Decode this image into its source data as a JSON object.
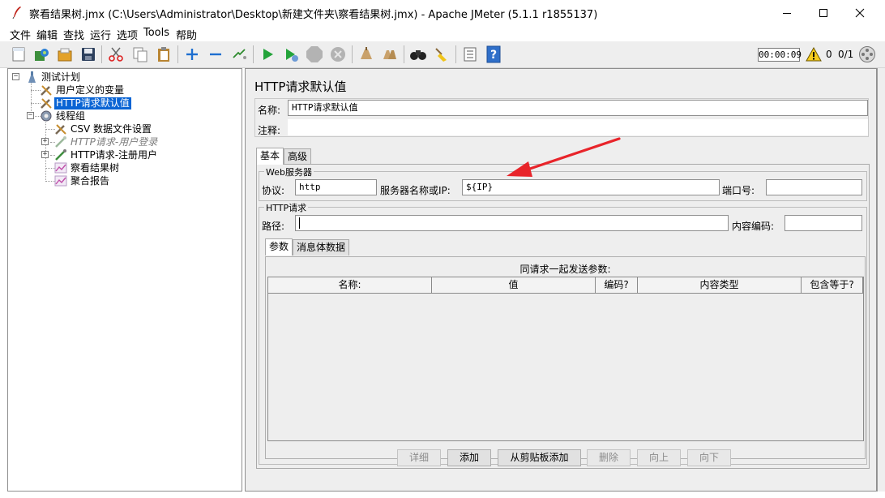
{
  "window": {
    "title": "察看结果树.jmx (C:\\Users\\Administrator\\Desktop\\新建文件夹\\察看结果树.jmx) - Apache JMeter (5.1.1 r1855137)"
  },
  "menu": [
    "文件",
    "编辑",
    "查找",
    "运行",
    "选项",
    "Tools",
    "帮助"
  ],
  "toolbar": {
    "timer": "00:00:09",
    "warning_count": "0",
    "threads": "0/1"
  },
  "tree": [
    {
      "label": "测试计划",
      "icon": "flask-icon"
    },
    {
      "label": "用户定义的变量",
      "icon": "wrench-icon"
    },
    {
      "label": "HTTP请求默认值",
      "icon": "wrench-icon",
      "selected": true
    },
    {
      "label": "线程组",
      "icon": "gear-icon"
    },
    {
      "label": "CSV 数据文件设置",
      "icon": "wrench-icon"
    },
    {
      "label": "HTTP请求-用户登录",
      "icon": "pipette-icon",
      "disabled": true
    },
    {
      "label": "HTTP请求-注册用户",
      "icon": "pipette-icon"
    },
    {
      "label": "察看结果树",
      "icon": "graph-icon"
    },
    {
      "label": "聚合报告",
      "icon": "graph-icon"
    }
  ],
  "panel": {
    "title": "HTTP请求默认值",
    "name_label": "名称:",
    "name_value": "HTTP请求默认值",
    "comment_label": "注释:",
    "comment_value": "",
    "tabs": [
      "基本",
      "高级"
    ],
    "web_server_group": "Web服务器",
    "protocol_label": "协议:",
    "protocol_value": "http",
    "server_label": "服务器名称或IP:",
    "server_value": "${IP}",
    "port_label": "端口号:",
    "port_value": "",
    "http_request_group": "HTTP请求",
    "path_label": "路径:",
    "path_value": "",
    "encoding_label": "内容编码:",
    "encoding_value": "",
    "sub_tabs": [
      "参数",
      "消息体数据"
    ],
    "params_caption": "同请求一起发送参数:",
    "columns": [
      "名称:",
      "值",
      "编码?",
      "内容类型",
      "包含等于?"
    ],
    "buttons": {
      "detail": "详细",
      "add": "添加",
      "add_clipboard": "从剪贴板添加",
      "delete": "删除",
      "up": "向上",
      "down": "向下"
    }
  },
  "colors": {
    "selection": "#0a64d4",
    "annotation_arrow": "#e8242a"
  }
}
